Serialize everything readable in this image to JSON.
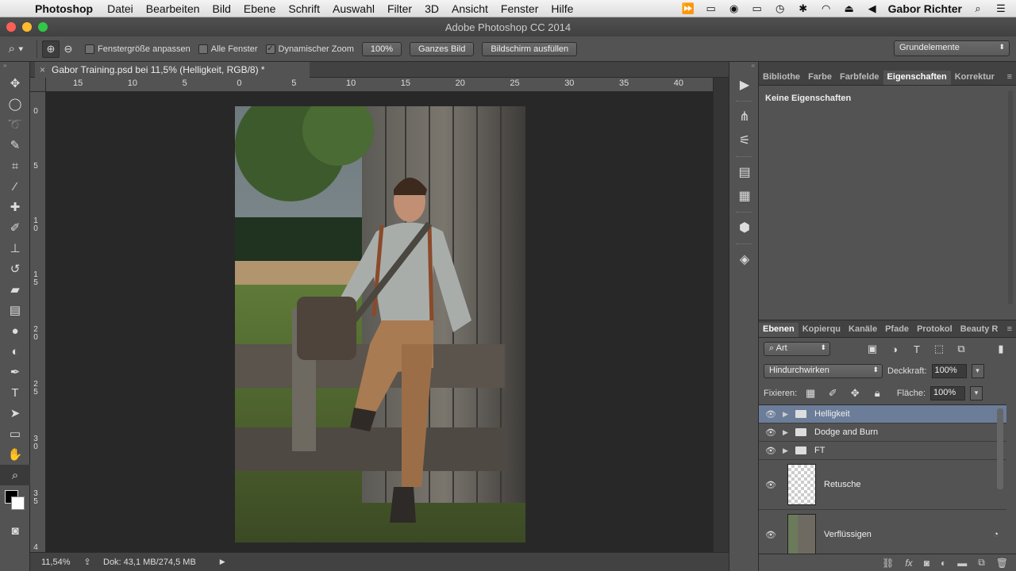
{
  "menubar": {
    "app": "Photoshop",
    "items": [
      "Datei",
      "Bearbeiten",
      "Bild",
      "Ebene",
      "Schrift",
      "Auswahl",
      "Filter",
      "3D",
      "Ansicht",
      "Fenster",
      "Hilfe"
    ],
    "user": "Gabor Richter"
  },
  "window": {
    "title": "Adobe Photoshop CC 2014"
  },
  "options": {
    "cb_resize": "Fenstergröße anpassen",
    "cb_all": "Alle Fenster",
    "cb_scrubby": "Dynamischer Zoom",
    "btn_100": "100%",
    "btn_fit": "Ganzes Bild",
    "btn_fill": "Bildschirm ausfüllen",
    "workspace": "Grundelemente"
  },
  "document": {
    "tab_title": "Gabor Training.psd bei 11,5% (Helligkeit, RGB/8) *",
    "ruler_h": [
      "15",
      "10",
      "5",
      "0",
      "5",
      "10",
      "15",
      "20",
      "25",
      "30",
      "35",
      "40"
    ],
    "ruler_v": [
      [
        "0"
      ],
      [
        "5"
      ],
      [
        "1",
        "0"
      ],
      [
        "1",
        "5"
      ],
      [
        "2",
        "0"
      ],
      [
        "2",
        "5"
      ],
      [
        "3",
        "0"
      ],
      [
        "3",
        "5"
      ],
      [
        "4",
        "0"
      ]
    ]
  },
  "status": {
    "zoom": "11,54%",
    "doc": "Dok: 43,1 MB/274,5 MB"
  },
  "properties": {
    "tabs": [
      "Bibliothe",
      "Farbe",
      "Farbfelde",
      "Eigenschaften",
      "Korrektur"
    ],
    "active_tab": 3,
    "message": "Keine Eigenschaften"
  },
  "layers": {
    "tabs": [
      "Ebenen",
      "Kopierqu",
      "Kanäle",
      "Pfade",
      "Protokol",
      "Beauty R"
    ],
    "active_tab": 0,
    "filter": "Art",
    "blend_mode": "Hindurchwirken",
    "opacity_label": "Deckkraft:",
    "opacity": "100%",
    "lock_label": "Fixieren:",
    "fill_label": "Fläche:",
    "fill": "100%",
    "items": [
      {
        "name": "Helligkeit"
      },
      {
        "name": "Dodge and Burn"
      },
      {
        "name": "FT"
      },
      {
        "name": "Retusche"
      },
      {
        "name": "Verflüssigen"
      }
    ]
  },
  "colors": {
    "accent_selected_layer": "#6b7d99",
    "panel": "#535353"
  }
}
